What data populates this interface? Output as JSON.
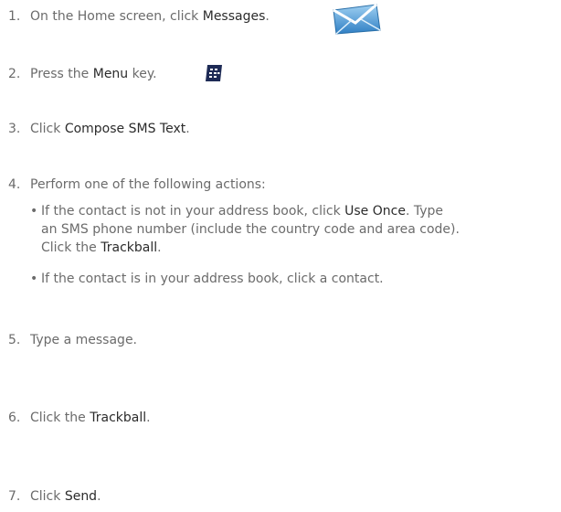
{
  "steps": [
    {
      "num": "1.",
      "pre": "On the Home screen, click ",
      "em": "Messages",
      "post": "."
    },
    {
      "num": "2.",
      "pre": "Press the ",
      "em": "Menu",
      "post": " key."
    },
    {
      "num": "3.",
      "pre": "Click ",
      "em": "Compose SMS Text",
      "post": "."
    },
    {
      "num": "4.",
      "text": "Perform one of the following actions:"
    },
    {
      "num": "5.",
      "text": "Type a message."
    },
    {
      "num": "6.",
      "pre": "Click the ",
      "em": "Trackball",
      "post": "."
    },
    {
      "num": "7.",
      "pre": "Click ",
      "em": "Send",
      "post": "."
    }
  ],
  "bullets": [
    {
      "dot": "•",
      "l1_pre": "If the contact is not in your address book, click ",
      "l1_em": "Use Once",
      "l1_post": ". Type",
      "l2": "an SMS phone number (include the country code and area code).",
      "l3_pre": "Click the ",
      "l3_em": "Trackball",
      "l3_post": "."
    },
    {
      "dot": "•",
      "text": "If the contact is in your address book, click a contact."
    }
  ],
  "icons": {
    "messages": "messages-envelope-icon",
    "menu": "blackberry-menu-key-icon"
  },
  "colors": {
    "text": "#6b6b6b",
    "emphasis": "#2b2b2b",
    "icon_blue": "#3a8fd0"
  }
}
